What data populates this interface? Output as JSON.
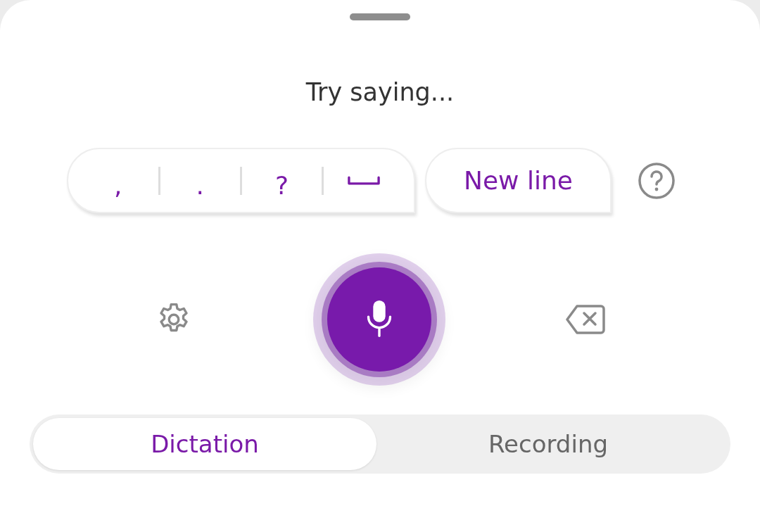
{
  "prompt": "Try saying...",
  "punctuation_keys": [
    {
      "kind": "text",
      "label": ","
    },
    {
      "kind": "text",
      "label": "."
    },
    {
      "kind": "text",
      "label": "?"
    },
    {
      "kind": "space"
    }
  ],
  "new_line_button": {
    "label": "New line"
  },
  "mode_tabs": [
    {
      "label": "Dictation",
      "selected": true
    },
    {
      "label": "Recording",
      "selected": false
    }
  ]
}
